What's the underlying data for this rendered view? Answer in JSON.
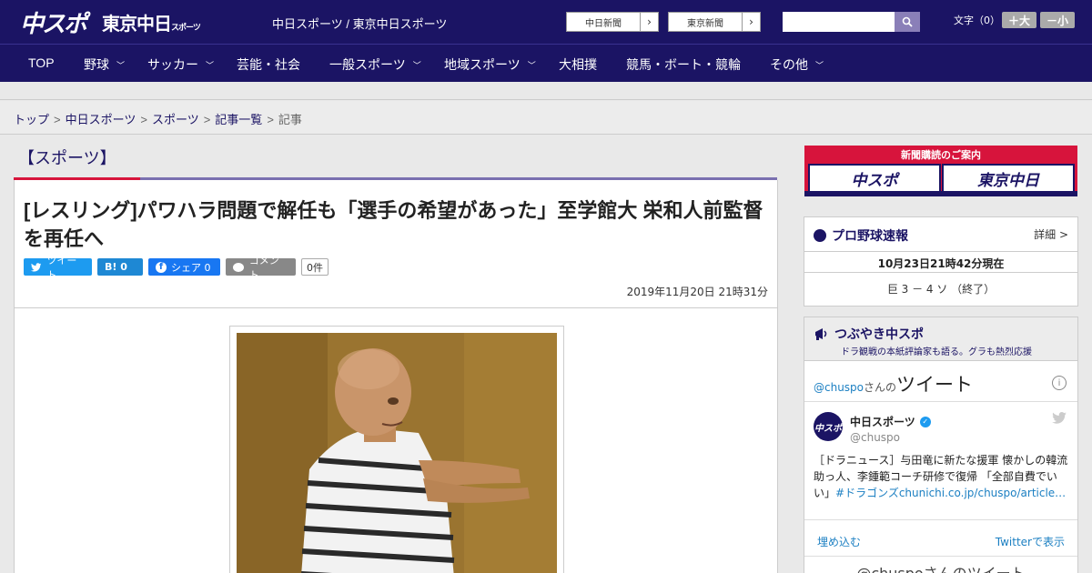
{
  "header": {
    "logo_chuspo": "中スポ",
    "logo_tokyo": "東京中日",
    "logo_tokyo_small": "スポーツ",
    "site_names": "中日スポーツ / 東京中日スポーツ",
    "paper_links": [
      "中日新聞",
      "東京新聞"
    ],
    "font_size_label": "文字（0）",
    "font_up": "＋大",
    "font_down": "－小"
  },
  "nav": {
    "items": [
      {
        "label": "TOP",
        "has_menu": false
      },
      {
        "label": "野球",
        "has_menu": true
      },
      {
        "label": "サッカー",
        "has_menu": true
      },
      {
        "label": "芸能・社会",
        "has_menu": false
      },
      {
        "label": "一般スポーツ",
        "has_menu": true
      },
      {
        "label": "地域スポーツ",
        "has_menu": true
      },
      {
        "label": "大相撲",
        "has_menu": false
      },
      {
        "label": "競馬・ボート・競輪",
        "has_menu": false
      },
      {
        "label": "その他",
        "has_menu": true
      }
    ]
  },
  "breadcrumb": [
    "トップ",
    "中日スポーツ",
    "スポーツ",
    "記事一覧",
    "記事"
  ],
  "article": {
    "section": "【スポーツ】",
    "headline": "[レスリング]パワハラ問題で解任も「選手の希望があった」至学館大 栄和人前監督を再任へ",
    "share": {
      "tweet": "ツイート",
      "hatena": "B! 0",
      "facebook": "シェア 0",
      "comment": "コメント",
      "comment_count": "0件"
    },
    "date": "2019年11月20日 21時31分"
  },
  "sidebar": {
    "subscribe_title": "新聞購読のご案内",
    "subscribe_buttons": [
      "中スポ",
      "東京中日"
    ],
    "baseball": {
      "title": "プロ野球速報",
      "detail": "詳細 >",
      "time": "10月23日21時42分現在",
      "score": "巨 3 － 4 ソ （終了）"
    },
    "tweets": {
      "title": "つぶやき中スポ",
      "subtitle": "ドラ観戦の本紙評論家も語る。グラも熱烈応援",
      "handle": "@chuspo",
      "handle_suffix": "さんの",
      "handle_big": "ツイート",
      "author_name": "中日スポーツ",
      "author_user": "@chuspo",
      "avatar_text": "中スポ",
      "text_main": "［ドラニュース］与田竜に新たな援軍 懐かしの韓流助っ人、李鍾範コーチ研修で復帰 「全部自費でい い」",
      "text_tag": "#ドラゴンズchunichi.co.jp/chuspo/article…",
      "embed": "埋め込む",
      "view": "Twitterで表示",
      "more": "@chuspoさんのツイート"
    }
  },
  "colors": {
    "navy": "#1b1464",
    "red": "#d7143c",
    "purple": "#7a70b0"
  }
}
